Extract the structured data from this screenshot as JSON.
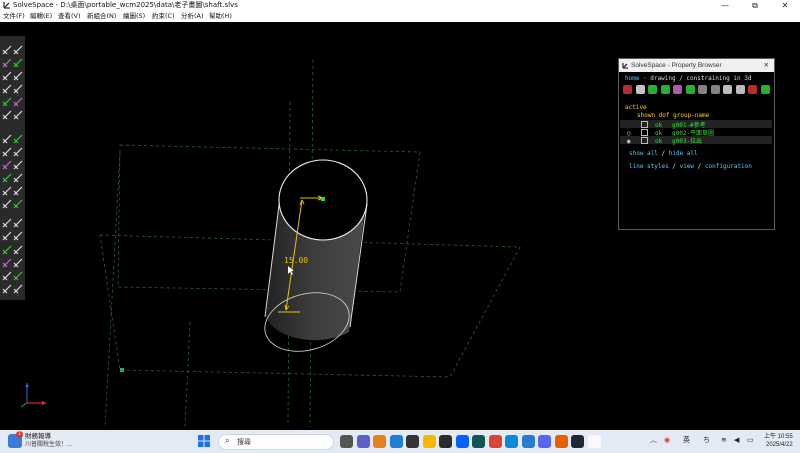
{
  "window": {
    "title": "SolveSpace - D:\\桌面\\portable_wcm2025\\data\\老子畫圖\\shaft.slvs",
    "controls": [
      "—",
      "⧉",
      "✕"
    ]
  },
  "menu": [
    "文件(F)",
    "編輯(E)",
    "查看(V)",
    "新組合(N)",
    "繪圖(S)",
    "約束(C)",
    "分析(A)",
    "幫助(H)"
  ],
  "canvas": {
    "dimension_label": "15.00"
  },
  "toolbar": {
    "icons": [
      "line-icon",
      "rectangle-icon",
      "circle-icon",
      "arc-icon",
      "text-icon",
      "image-icon",
      "bezier-icon",
      "spline-icon",
      "point-icon",
      "tangent-arc-icon",
      "construction-icon",
      "split-icon",
      "distance-constraint-icon",
      "angle-constraint-icon",
      "horizontal-constraint-icon",
      "vertical-constraint-icon",
      "parallel-constraint-icon",
      "perpendicular-constraint-icon",
      "tangent-icon",
      "equal-icon",
      "point-on-icon",
      "symmetric-icon",
      "midpoint-icon",
      "reference-icon",
      "workplane-icon",
      "extrude-icon",
      "lathe-icon",
      "revolve-icon",
      "helix-icon",
      "step-icon",
      "sketch-icon",
      "import-icon",
      "assembly-icon",
      "nearest-icon",
      "compact-icon",
      "ortho-icon"
    ]
  },
  "property_browser": {
    "title": "SolveSpace - Property Browser",
    "close": "✕",
    "nav_home": "home",
    "nav_rest": " · drawing / constraining in 3d",
    "active_label": "active",
    "columns": "shown dof group-name",
    "groups": [
      {
        "radio": "",
        "dof": "ok",
        "name": "g001-#參考"
      },
      {
        "radio": "○",
        "dof": "ok",
        "name": "g002-平面草圖"
      },
      {
        "radio": "◉",
        "dof": "ok",
        "name": "g003-拉出"
      }
    ],
    "show_all": "show all",
    "slash": " / ",
    "hide_all": "hide all",
    "line_styles": "line styles",
    "view": "view",
    "configuration": "configuration"
  },
  "taskbar": {
    "weather_title": "財務報導",
    "weather_sub": "川普關稅生效！...",
    "notification_count": "1",
    "search_placeholder": "搜尋",
    "time": "上午 10:55",
    "date": "2025/4/22",
    "lang": "英"
  }
}
